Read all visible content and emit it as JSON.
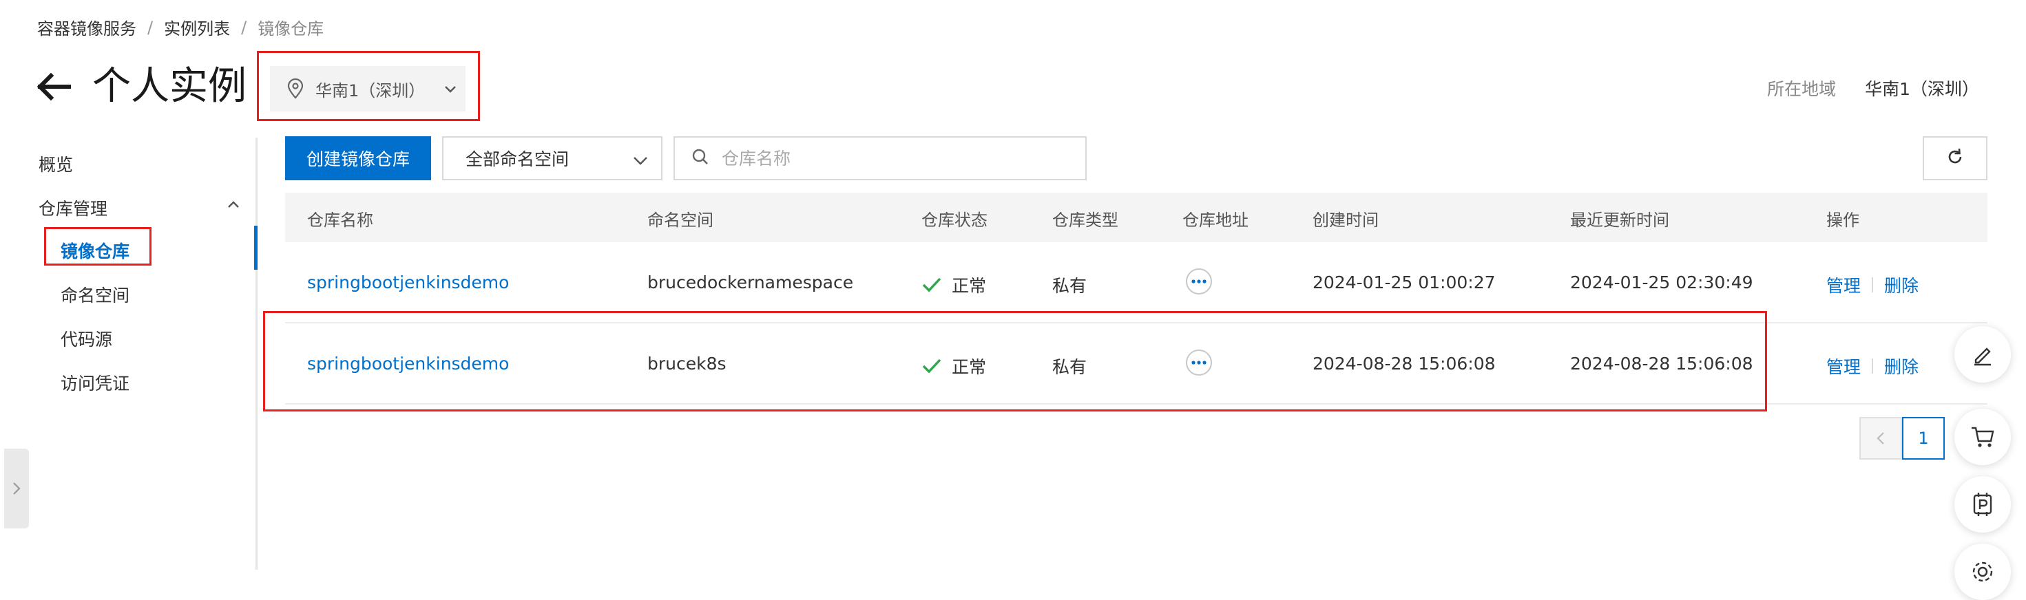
{
  "breadcrumb": {
    "items": [
      "容器镜像服务",
      "实例列表",
      "镜像仓库"
    ],
    "separator": "/"
  },
  "header": {
    "title": "个人实例",
    "region_select": "华南1（深圳）",
    "region_label": "所在地域",
    "region_value": "华南1（深圳）"
  },
  "sidebar": {
    "overview": "概览",
    "group": "仓库管理",
    "items": [
      "镜像仓库",
      "命名空间",
      "代码源",
      "访问凭证"
    ]
  },
  "toolbar": {
    "create_button": "创建镜像仓库",
    "namespace_filter": "全部命名空间",
    "search_placeholder": "仓库名称"
  },
  "table": {
    "columns": [
      "仓库名称",
      "命名空间",
      "仓库状态",
      "仓库类型",
      "仓库地址",
      "创建时间",
      "最近更新时间",
      "操作"
    ],
    "rows": [
      {
        "name": "springbootjenkinsdemo",
        "namespace": "brucedockernamespace",
        "status": "正常",
        "type": "私有",
        "created": "2024-01-25 01:00:27",
        "updated": "2024-01-25 02:30:49",
        "manage": "管理",
        "delete": "删除"
      },
      {
        "name": "springbootjenkinsdemo",
        "namespace": "brucek8s",
        "status": "正常",
        "type": "私有",
        "created": "2024-08-28 15:06:08",
        "updated": "2024-08-28 15:06:08",
        "manage": "管理",
        "delete": "删除"
      }
    ]
  },
  "pagination": {
    "current": "1"
  },
  "colors": {
    "accent": "#0070cc",
    "highlight": "#e8201d",
    "success": "#2aa84a"
  },
  "icons": [
    "back-arrow-icon",
    "location-pin-icon",
    "chevron-down-icon",
    "chevron-up-icon",
    "search-icon",
    "refresh-icon",
    "check-icon",
    "more-dots-icon",
    "chevron-left-icon",
    "edit-icon",
    "cart-icon",
    "parking-icon",
    "settings-icon"
  ]
}
